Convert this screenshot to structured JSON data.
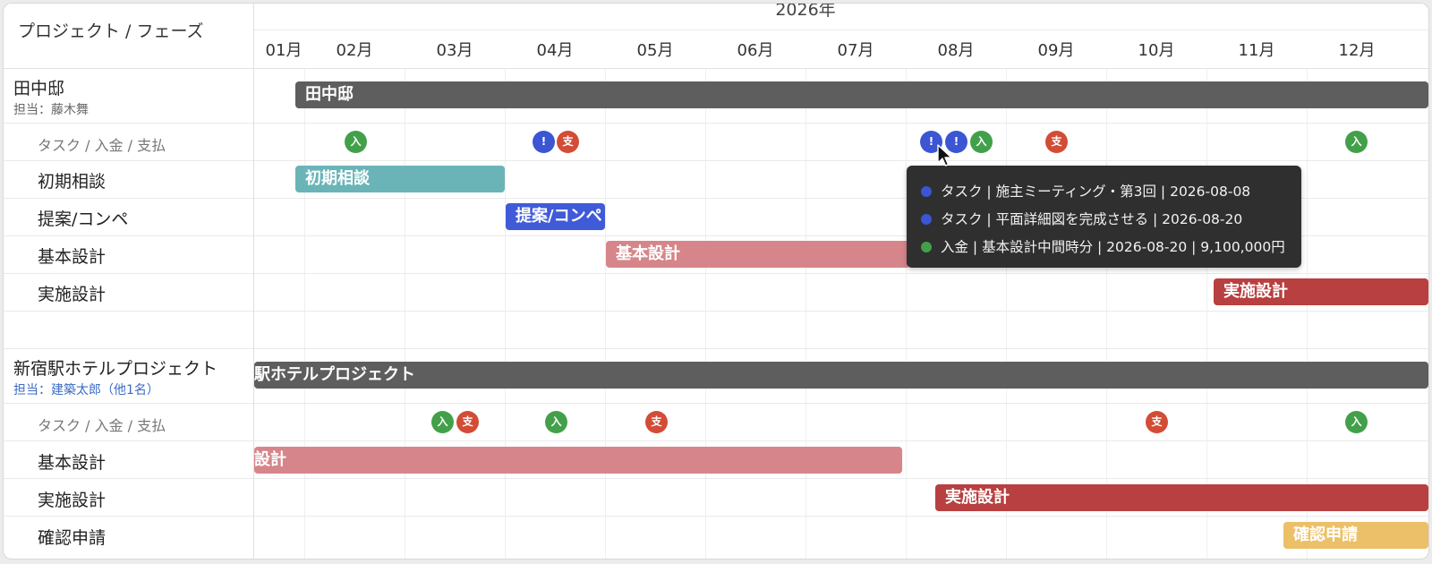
{
  "header": {
    "label": "プロジェクト / フェーズ",
    "year": "2026年",
    "months": [
      "01月",
      "02月",
      "03月",
      "04月",
      "05月",
      "06月",
      "07月",
      "08月",
      "09月",
      "10月",
      "11月",
      "12月"
    ]
  },
  "colors": {
    "project_bar": "#5e5e5e",
    "phase_initial": "#6ab4b8",
    "phase_proposal": "#3f5bd8",
    "phase_basic": "#d6868a",
    "phase_detail": "#b84040",
    "phase_permit": "#ecc068",
    "marker_task": "#3b55d3",
    "marker_deposit": "#43a04a",
    "marker_payment": "#d24c36",
    "tooltip_bg": "#2f2f2f"
  },
  "projects": [
    {
      "name": "田中邸",
      "assignee": "担当：藤木舞",
      "bar_label": "田中邸",
      "events_label": "タスク / 入金 / 支払",
      "markers": [
        {
          "glyph": "入"
        },
        {
          "glyph": "!"
        },
        {
          "glyph": "支"
        },
        {
          "glyph": "!"
        },
        {
          "glyph": "!"
        },
        {
          "glyph": "入"
        },
        {
          "glyph": "支"
        },
        {
          "glyph": "入"
        }
      ],
      "phases": [
        {
          "label": "初期相談",
          "bar_label": "初期相談"
        },
        {
          "label": "提案/コンペ",
          "bar_label": "提案/コンペ"
        },
        {
          "label": "基本設計",
          "bar_label": "基本設計"
        },
        {
          "label": "実施設計",
          "bar_label": "実施設計"
        }
      ]
    },
    {
      "name": "新宿駅ホテルプロジェクト",
      "assignee": "担当：建築太郎（他1名）",
      "bar_label": "駅ホテルプロジェクト",
      "events_label": "タスク / 入金 / 支払",
      "markers": [
        {
          "glyph": "入"
        },
        {
          "glyph": "支"
        },
        {
          "glyph": "入"
        },
        {
          "glyph": "支"
        },
        {
          "glyph": "支"
        },
        {
          "glyph": "入"
        }
      ],
      "phases": [
        {
          "label": "基本設計",
          "bar_label": "設計"
        },
        {
          "label": "実施設計",
          "bar_label": "実施設計"
        },
        {
          "label": "確認申請",
          "bar_label": "確認申請"
        }
      ]
    }
  ],
  "tooltip": {
    "items": [
      {
        "text": "タスク | 施主ミーティング・第3回 | 2026-08-08",
        "color": "#3b55d3"
      },
      {
        "text": "タスク | 平面詳細図を完成させる | 2026-08-20",
        "color": "#3b55d3"
      },
      {
        "text": "入金 | 基本設計中間時分 | 2026-08-20 | 9,100,000円",
        "color": "#43a04a"
      }
    ]
  }
}
